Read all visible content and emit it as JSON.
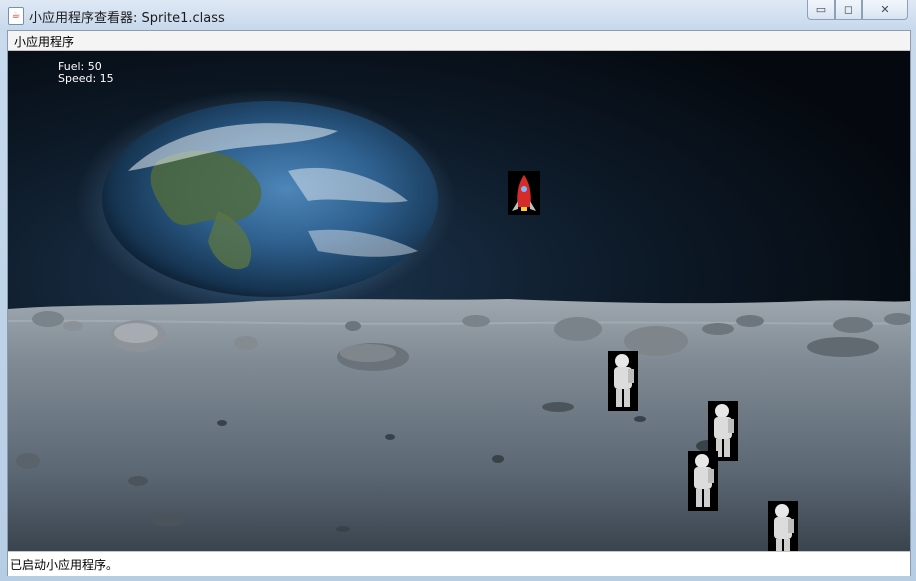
{
  "window": {
    "title": "小应用程序查看器: Sprite1.class",
    "app_icon": "java-cup-icon"
  },
  "menu": {
    "label": "小应用程序"
  },
  "hud": {
    "fuel": "Fuel: 50",
    "speed": "Speed: 15"
  },
  "status": {
    "text": "已启动小应用程序。"
  },
  "sprites": {
    "rocket": "rocket-sprite",
    "astronaut": "astronaut-sprite"
  },
  "colors": {
    "sky": "#0a1420",
    "ground": "#6a7682",
    "rocket_body": "#d62b2b"
  }
}
